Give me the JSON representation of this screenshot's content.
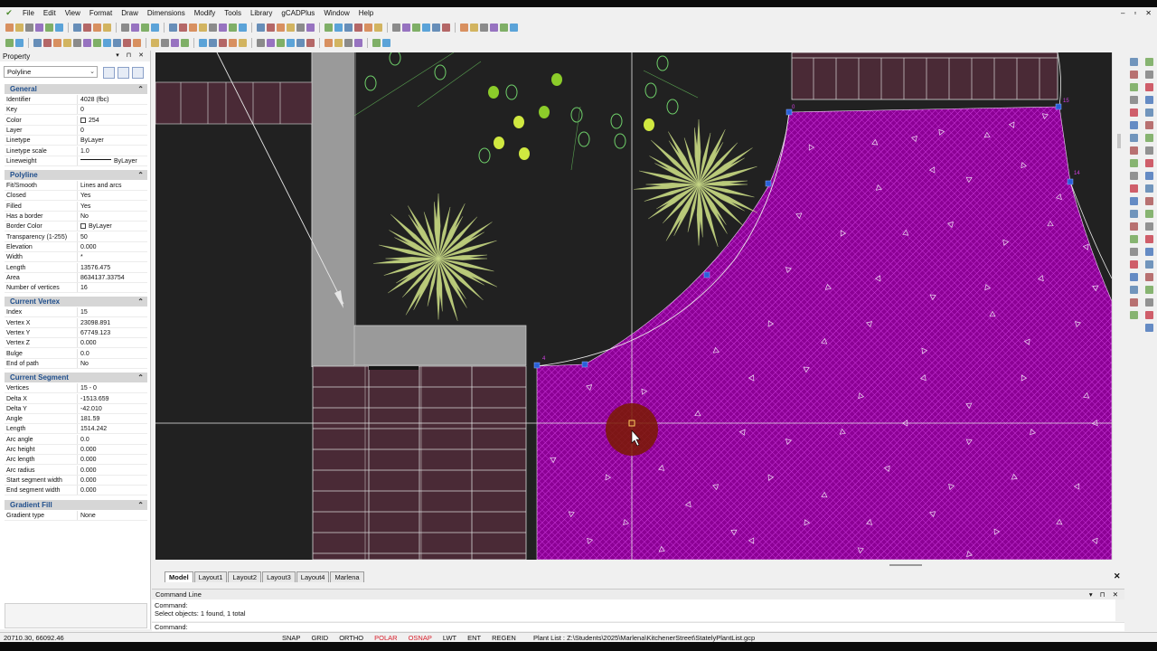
{
  "menu": [
    "File",
    "Edit",
    "View",
    "Format",
    "Draw",
    "Dimensions",
    "Modify",
    "Tools",
    "Library",
    "gCADPlus",
    "Window",
    "Help"
  ],
  "window_controls": [
    "–",
    "▫",
    "✕"
  ],
  "property_panel": {
    "title": "Property",
    "header_controls": "▾ ⊓ ✕",
    "selected_type": "Polyline",
    "sections": [
      {
        "title": "General",
        "rows": [
          {
            "key": "Identifier",
            "value": "4028 (fbc)"
          },
          {
            "key": "Key",
            "value": "0"
          },
          {
            "key": "Color",
            "value": "254",
            "swatch": "#ffffff"
          },
          {
            "key": "Layer",
            "value": "0"
          },
          {
            "key": "Linetype",
            "value": "ByLayer"
          },
          {
            "key": "Linetype scale",
            "value": "1.0"
          },
          {
            "key": "Lineweight",
            "value": "ByLayer",
            "lineweight": true
          }
        ]
      },
      {
        "title": "Polyline",
        "rows": [
          {
            "key": "Fit/Smooth",
            "value": "Lines and arcs"
          },
          {
            "key": "Closed",
            "value": "Yes"
          },
          {
            "key": "Filled",
            "value": "Yes"
          },
          {
            "key": "Has a border",
            "value": "No"
          },
          {
            "key": "Border Color",
            "value": "ByLayer",
            "swatch": "#ffffff"
          },
          {
            "key": "Transparency (1-255)",
            "value": "50"
          },
          {
            "key": "Elevation",
            "value": "0.000"
          },
          {
            "key": "Width",
            "value": "*"
          },
          {
            "key": "Length",
            "value": "13576.475"
          },
          {
            "key": "Area",
            "value": "8634137.33754"
          },
          {
            "key": "Number of vertices",
            "value": "16"
          }
        ]
      },
      {
        "title": "Current Vertex",
        "rows": [
          {
            "key": "Index",
            "value": "15"
          },
          {
            "key": "Vertex X",
            "value": "23098.891"
          },
          {
            "key": "Vertex Y",
            "value": "67749.123"
          },
          {
            "key": "Vertex Z",
            "value": "0.000"
          },
          {
            "key": "Bulge",
            "value": "0.0"
          },
          {
            "key": "End of path",
            "value": "No"
          }
        ]
      },
      {
        "title": "Current Segment",
        "rows": [
          {
            "key": "Vertices",
            "value": "15 - 0"
          },
          {
            "key": "Delta X",
            "value": "-1513.659"
          },
          {
            "key": "Delta Y",
            "value": "-42.010"
          },
          {
            "key": "Angle",
            "value": "181.59"
          },
          {
            "key": "Length",
            "value": "1514.242"
          },
          {
            "key": "Arc angle",
            "value": "0.0"
          },
          {
            "key": "Arc height",
            "value": "0.000"
          },
          {
            "key": "Arc length",
            "value": "0.000"
          },
          {
            "key": "Arc radius",
            "value": "0.000"
          },
          {
            "key": "Start segment width",
            "value": "0.000"
          },
          {
            "key": "End segment width",
            "value": "0.000"
          }
        ]
      },
      {
        "title": "Gradient Fill",
        "rows": [
          {
            "key": "Gradient type",
            "value": "None"
          }
        ]
      }
    ]
  },
  "canvas": {
    "background": "#212121",
    "hatch_color": "#a000b0",
    "paving_color": "#4a2a36",
    "vertex_labels": [
      "0",
      "15",
      "14",
      "4"
    ]
  },
  "tabs": [
    "Model",
    "Layout1",
    "Layout2",
    "Layout3",
    "Layout4",
    "Marlena"
  ],
  "active_tab": "Model",
  "command_line": {
    "title": "Command Line",
    "controls": "▾ ⊓ ✕",
    "history": [
      "Command:",
      "Select objects: 1 found,  1 total"
    ],
    "prompt": "Command:"
  },
  "status_bar": {
    "coords": "20710.30, 66092.46",
    "buttons": [
      {
        "label": "SNAP",
        "on": false
      },
      {
        "label": "GRID",
        "on": false
      },
      {
        "label": "ORTHO",
        "on": false
      },
      {
        "label": "POLAR",
        "on": true
      },
      {
        "label": "OSNAP",
        "on": true
      },
      {
        "label": "LWT",
        "on": false
      },
      {
        "label": "ENT",
        "on": false
      },
      {
        "label": "REGEN",
        "on": false
      }
    ],
    "plant_list": "Plant List : Z:\\Students\\2025\\Marlena\\KitchenerStreet\\StatelyPlantList.gcp"
  }
}
